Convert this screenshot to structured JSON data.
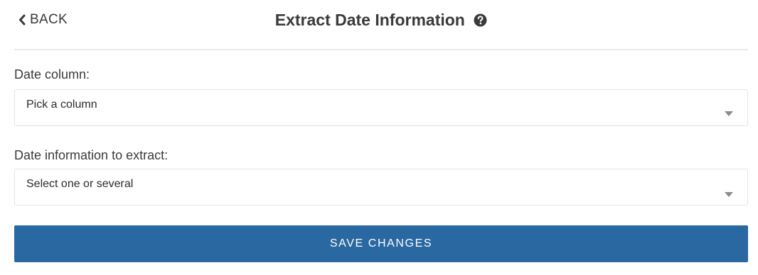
{
  "header": {
    "back_label": "BACK",
    "title": "Extract Date Information"
  },
  "form": {
    "date_column": {
      "label": "Date column:",
      "placeholder": "Pick a column"
    },
    "date_info": {
      "label": "Date information to extract:",
      "placeholder": "Select one or several"
    }
  },
  "actions": {
    "save_label": "SAVE CHANGES"
  },
  "colors": {
    "primary_button": "#2a68a2",
    "text": "#3a3a3a",
    "border": "#e4e4e4"
  },
  "icons": {
    "back": "chevron-left-icon",
    "help": "question-circle-icon",
    "dropdown": "caret-down-icon"
  }
}
